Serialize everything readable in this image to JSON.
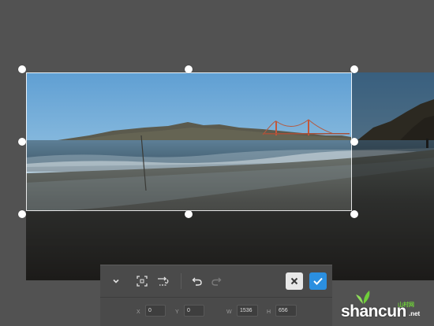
{
  "toolbar": {
    "collapse_icon": "chevron-down-icon",
    "crop_icon": "crop-frame-icon",
    "rotate_icon": "rotate-icon",
    "undo_icon": "undo-icon",
    "redo_icon": "redo-icon",
    "cancel_icon": "close-icon",
    "confirm_icon": "checkmark-icon",
    "confirm_color": "#2b8fe0",
    "fields": {
      "x": {
        "label": "X",
        "value": "0"
      },
      "y": {
        "label": "Y",
        "value": "0"
      },
      "w": {
        "label": "W",
        "value": "1536"
      },
      "h": {
        "label": "H",
        "value": "656"
      }
    }
  },
  "watermark": {
    "text": "shancun",
    "small": "山村网",
    "suffix": ".net"
  }
}
